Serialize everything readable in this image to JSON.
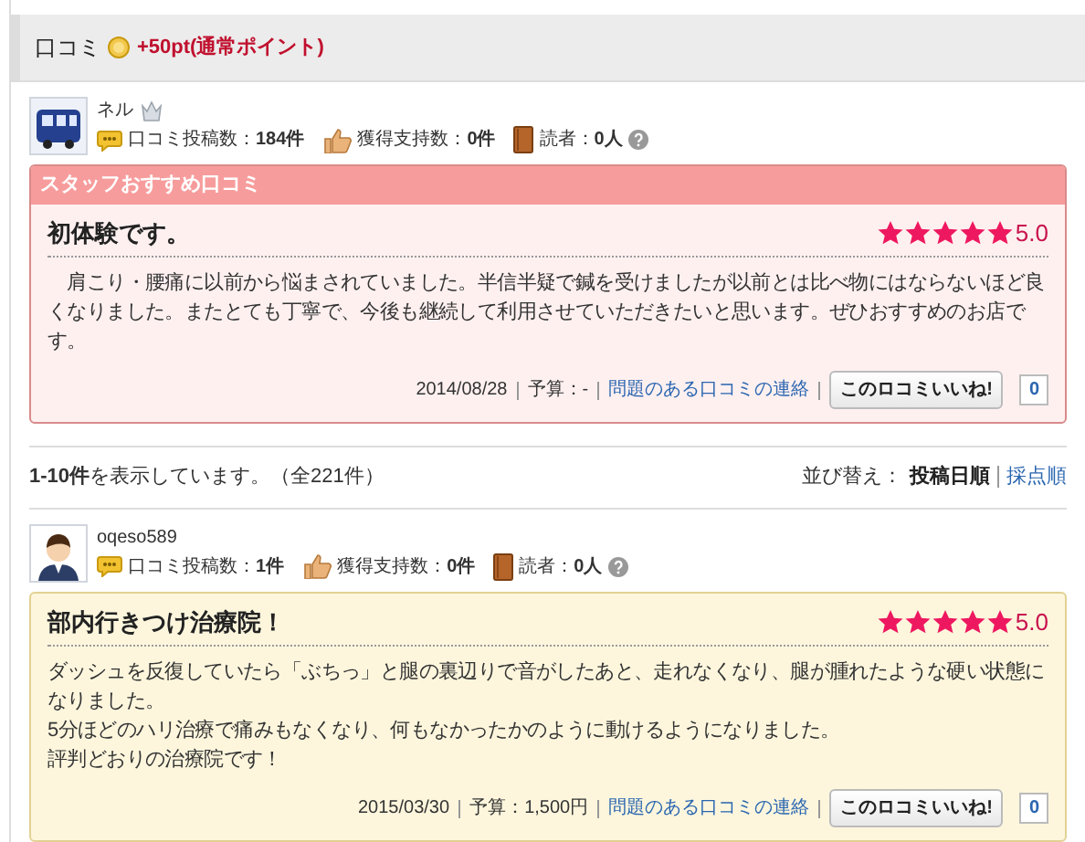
{
  "header": {
    "title": "口コミ",
    "points": "+50pt(通常ポイント)"
  },
  "reviews": [
    {
      "kind": "staff",
      "badge": "スタッフおすすめ口コミ",
      "avatar": {
        "kind": "train"
      },
      "user": "ネル",
      "crown": true,
      "stats": [
        "口コミ投稿数：**184件**",
        "獲得支持数：**0件**",
        "読者：**0人**"
      ],
      "title": "初体験です。",
      "stars": 5,
      "score": "5.0",
      "body": [
        "　肩こり・腰痛に以前から悩まされていました。半信半疑で鍼を受けましたが以前とは比べ物にはならないほど良くなりました。またとても丁寧で、今後も継続して利用させていただきたいと思います。ぜひおすすめのお店です。"
      ],
      "date": "2014/08/28",
      "budget": "予算：-",
      "report": "問題のある口コミの連絡",
      "like": "このロコミいいね!",
      "likes": "0"
    },
    {
      "kind": "normal",
      "avatar": {
        "kind": "person"
      },
      "user": "oqeso589",
      "crown": false,
      "stats": [
        "口コミ投稿数：**1件**",
        "獲得支持数：**0件**",
        "読者：**0人**"
      ],
      "title": "部内行きつけ治療院！",
      "stars": 5,
      "score": "5.0",
      "body": [
        "ダッシュを反復していたら「ぶちっ」と腿の裏辺りで音がしたあと、走れなくなり、腿が腫れたような硬い状態になりました。",
        "5分ほどのハリ治療で痛みもなくなり、何もなかったかのように動けるようになりました。",
        "評判どおりの治療院です！"
      ],
      "date": "2015/03/30",
      "budget": "予算：1,500円",
      "report": "問題のある口コミの連絡",
      "like": "このロコミいいね!",
      "likes": "0"
    }
  ],
  "listing": {
    "summary": "**1-10件**を表示しています。（全221件）",
    "sort_label": "並び替え：",
    "sort_options": [
      {
        "label": "投稿日順",
        "selected": true
      },
      {
        "label": "採点順",
        "selected": false
      }
    ]
  }
}
